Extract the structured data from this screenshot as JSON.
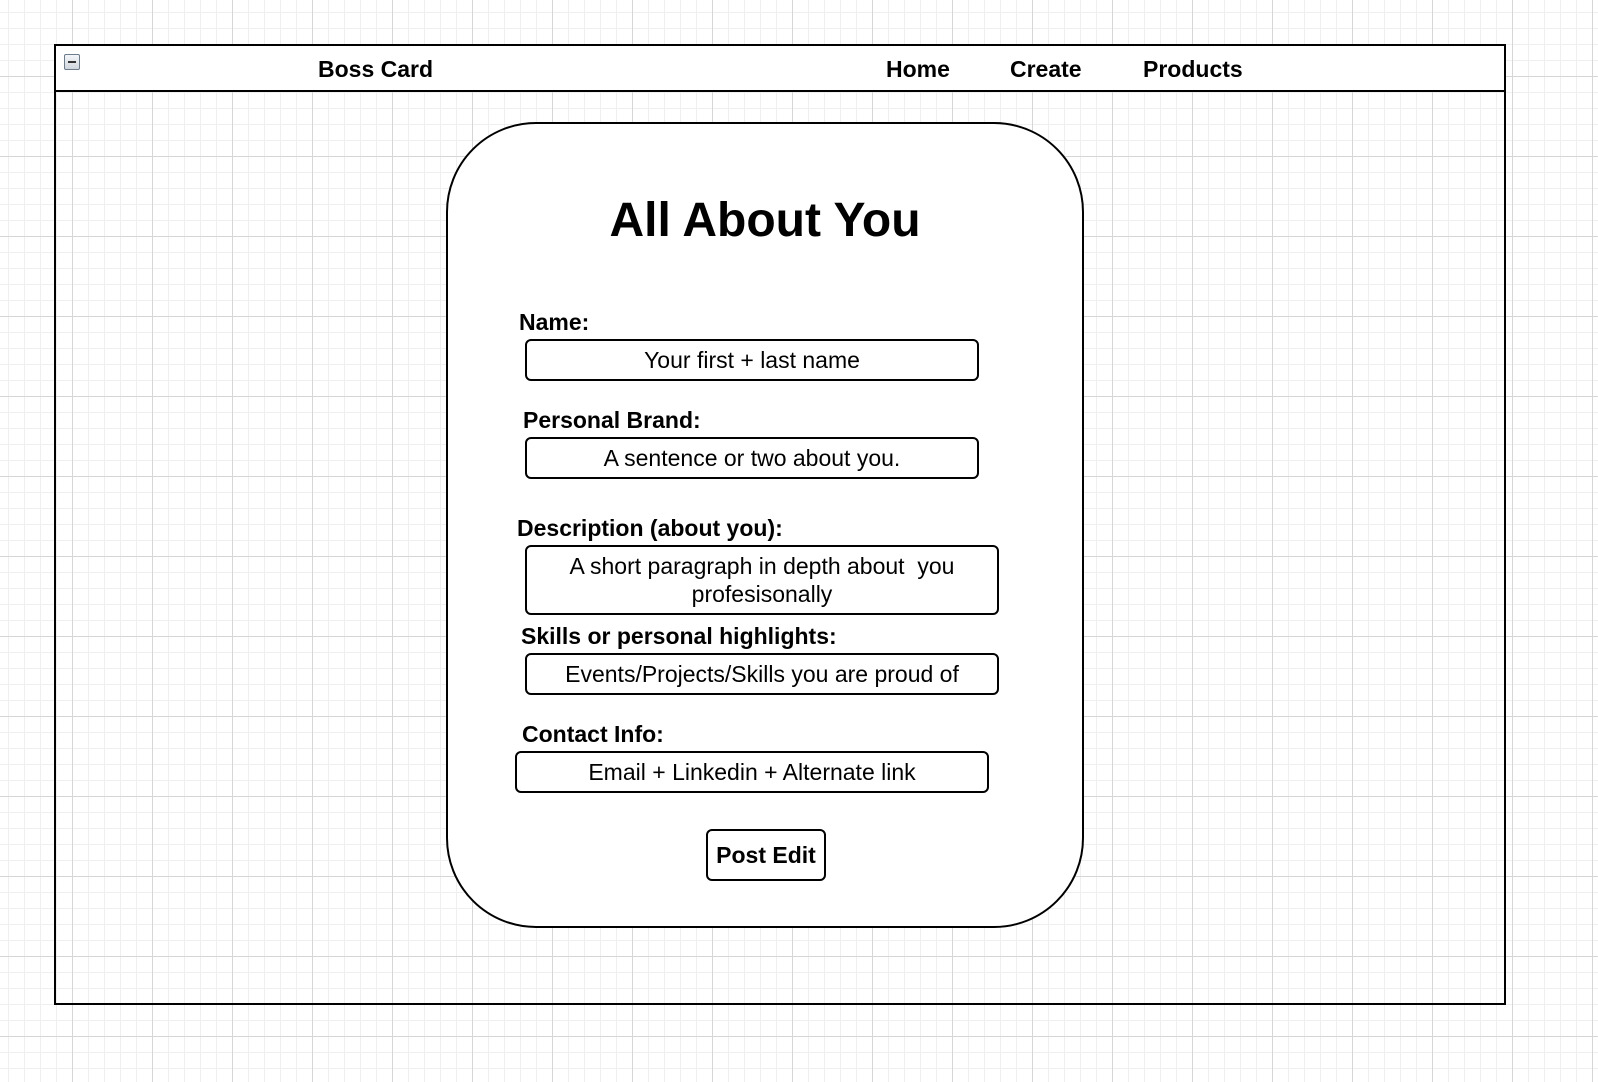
{
  "nav": {
    "brand": "Boss Card",
    "links": [
      "Home",
      "Create",
      "Products"
    ],
    "collapse_icon": "collapse-minus-icon"
  },
  "form": {
    "title": "All About You",
    "fields": [
      {
        "label": "Name:",
        "placeholder": "Your first + last name"
      },
      {
        "label": "Personal Brand:",
        "placeholder": "A sentence or two about you."
      },
      {
        "label": "Description (about you):",
        "placeholder_lines": [
          "A short paragraph in depth about  you",
          "profesisonally"
        ]
      },
      {
        "label": "Skills or personal highlights:",
        "placeholder": "Events/Projects/Skills you are proud of"
      },
      {
        "label": "Contact Info:",
        "placeholder": "Email + Linkedin + Alternate link"
      }
    ],
    "submit_label": "Post Edit"
  }
}
